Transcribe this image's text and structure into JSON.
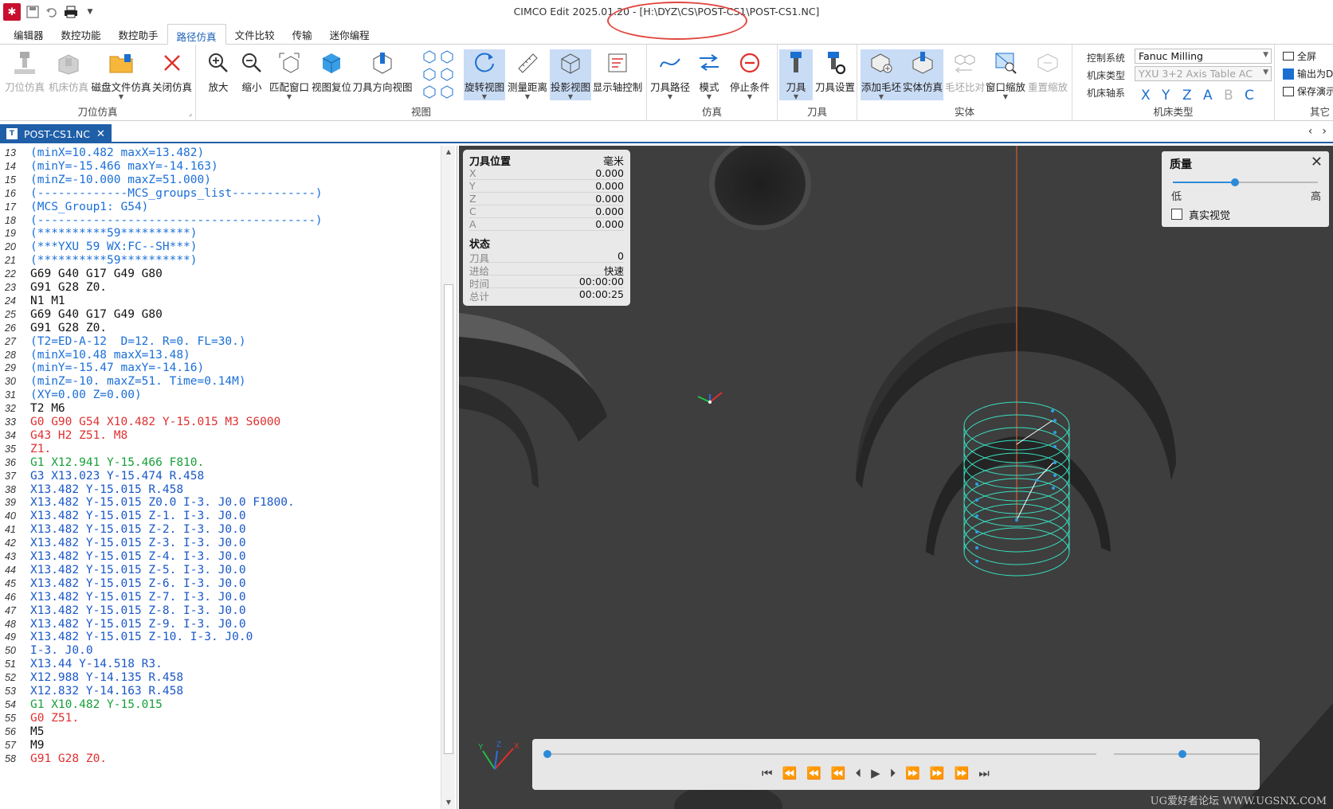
{
  "titlebar": {
    "title": "CIMCO Edit 2025.01.20 - [H:\\DYZ\\CS\\POST-CS1\\POST-CS1.NC]",
    "qat_icons": [
      "app-logo-icon",
      "save-icon",
      "undo-icon",
      "print-icon",
      "customize-qat-icon"
    ]
  },
  "tabs": [
    "编辑器",
    "数控功能",
    "数控助手",
    "路径仿真",
    "文件比较",
    "传输",
    "迷你编程"
  ],
  "active_tab": "路径仿真",
  "ribbon": {
    "groups": {
      "toolpos": "刀位仿真",
      "view": "视图",
      "sim": "仿真",
      "tool": "刀具",
      "solid": "实体",
      "machine": "机床类型",
      "other": "其它"
    },
    "buttons": {
      "tool_sim": "刀位仿真",
      "machine_sim": "机床仿真",
      "disk_sim": "磁盘文件仿真",
      "close_sim": "关闭仿真",
      "zoom_in": "放大",
      "zoom_out": "缩小",
      "fit_window": "匹配窗口",
      "view_reset": "视图复位",
      "tool_dir_view": "刀具方向视图",
      "rotate_view": "旋转视图",
      "measure": "测量距离",
      "projection": "投影视图",
      "show_axis": "显示轴控制",
      "toolpath": "刀具路径",
      "mode": "模式",
      "stop_cond": "停止条件",
      "tool": "刀具",
      "tool_settings": "刀具设置",
      "add_stock": "添加毛坯",
      "solid_sim": "实体仿真",
      "stock_compare": "毛坯比对",
      "window_zoom": "窗口缩放",
      "rezoom": "重置缩放"
    },
    "machine": {
      "control_label": "控制系统",
      "control_value": "Fanuc Milling",
      "type_label": "机床类型",
      "type_value": "YXU 3+2 Axis  Table AC",
      "axes_label": "机床轴系",
      "axes": [
        "X",
        "Y",
        "Z",
        "A",
        "B",
        "C"
      ]
    },
    "other": {
      "fullscreen": "全屏",
      "export": "输出为D",
      "save_demo": "保存演示"
    }
  },
  "doc_tab": {
    "name": "POST-CS1.NC"
  },
  "editor": {
    "lines": [
      {
        "n": "13",
        "t": "(minX=10.482 maxX=13.482)",
        "c": "comment"
      },
      {
        "n": "14",
        "t": "(minY=-15.466 maxY=-14.163)",
        "c": "comment"
      },
      {
        "n": "15",
        "t": "(minZ=-10.000 maxZ=51.000)",
        "c": "comment"
      },
      {
        "n": "16",
        "t": "(-------------MCS_groups_list------------)",
        "c": "comment"
      },
      {
        "n": "17",
        "t": "(MCS_Group1: G54)",
        "c": "comment"
      },
      {
        "n": "18",
        "t": "(----------------------------------------)",
        "c": "comment"
      },
      {
        "n": "19",
        "t": "(**********59**********)",
        "c": "comment"
      },
      {
        "n": "20",
        "t": "(***YXU 59 WX:FC--SH***)",
        "c": "comment"
      },
      {
        "n": "21",
        "t": "(**********59**********)",
        "c": "comment"
      },
      {
        "n": "22",
        "t": "G69 G40 G17 G49 G80",
        "c": "black"
      },
      {
        "n": "23",
        "t": "G91 G28 Z0.",
        "c": "black"
      },
      {
        "n": "24",
        "t": "N1 M1",
        "c": "black"
      },
      {
        "n": "25",
        "t": "G69 G40 G17 G49 G80",
        "c": "black"
      },
      {
        "n": "26",
        "t": "G91 G28 Z0.",
        "c": "black"
      },
      {
        "n": "27",
        "t": "(T2=ED-A-12  D=12. R=0. FL=30.)",
        "c": "comment"
      },
      {
        "n": "28",
        "t": "(minX=10.48 maxX=13.48)",
        "c": "comment"
      },
      {
        "n": "29",
        "t": "(minY=-15.47 maxY=-14.16)",
        "c": "comment"
      },
      {
        "n": "30",
        "t": "(minZ=-10. maxZ=51. Time=0.14M)",
        "c": "comment"
      },
      {
        "n": "31",
        "t": "(XY=0.00 Z=0.00)",
        "c": "comment"
      },
      {
        "n": "32",
        "t": "T2 M6",
        "c": "black"
      },
      {
        "n": "33",
        "t": "G0 G90 G54 X10.482 Y-15.015 M3 S6000",
        "c": "red"
      },
      {
        "n": "34",
        "t": "G43 H2 Z51. M8",
        "c": "red"
      },
      {
        "n": "35",
        "t": "Z1.",
        "c": "red"
      },
      {
        "n": "36",
        "t": "G1 X12.941 Y-15.466 F810.",
        "c": "green"
      },
      {
        "n": "37",
        "t": "G3 X13.023 Y-15.474 R.458",
        "c": "blue"
      },
      {
        "n": "38",
        "t": "X13.482 Y-15.015 R.458",
        "c": "blue"
      },
      {
        "n": "39",
        "t": "X13.482 Y-15.015 Z0.0 I-3. J0.0 F1800.",
        "c": "blue"
      },
      {
        "n": "40",
        "t": "X13.482 Y-15.015 Z-1. I-3. J0.0",
        "c": "blue"
      },
      {
        "n": "41",
        "t": "X13.482 Y-15.015 Z-2. I-3. J0.0",
        "c": "blue"
      },
      {
        "n": "42",
        "t": "X13.482 Y-15.015 Z-3. I-3. J0.0",
        "c": "blue"
      },
      {
        "n": "43",
        "t": "X13.482 Y-15.015 Z-4. I-3. J0.0",
        "c": "blue"
      },
      {
        "n": "44",
        "t": "X13.482 Y-15.015 Z-5. I-3. J0.0",
        "c": "blue"
      },
      {
        "n": "45",
        "t": "X13.482 Y-15.015 Z-6. I-3. J0.0",
        "c": "blue"
      },
      {
        "n": "46",
        "t": "X13.482 Y-15.015 Z-7. I-3. J0.0",
        "c": "blue"
      },
      {
        "n": "47",
        "t": "X13.482 Y-15.015 Z-8. I-3. J0.0",
        "c": "blue"
      },
      {
        "n": "48",
        "t": "X13.482 Y-15.015 Z-9. I-3. J0.0",
        "c": "blue"
      },
      {
        "n": "49",
        "t": "X13.482 Y-15.015 Z-10. I-3. J0.0",
        "c": "blue"
      },
      {
        "n": "50",
        "t": "I-3. J0.0",
        "c": "blue"
      },
      {
        "n": "51",
        "t": "X13.44 Y-14.518 R3.",
        "c": "blue"
      },
      {
        "n": "52",
        "t": "X12.988 Y-14.135 R.458",
        "c": "blue"
      },
      {
        "n": "53",
        "t": "X12.832 Y-14.163 R.458",
        "c": "blue"
      },
      {
        "n": "54",
        "t": "G1 X10.482 Y-15.015",
        "c": "green"
      },
      {
        "n": "55",
        "t": "G0 Z51.",
        "c": "red"
      },
      {
        "n": "56",
        "t": "M5",
        "c": "black"
      },
      {
        "n": "57",
        "t": "M9",
        "c": "black"
      },
      {
        "n": "58",
        "t": "G91 G28 Z0.",
        "c": "red"
      }
    ]
  },
  "toolpos_panel": {
    "title": "刀具位置",
    "unit": "毫米",
    "coords": [
      {
        "k": "X",
        "v": "0.000"
      },
      {
        "k": "Y",
        "v": "0.000"
      },
      {
        "k": "Z",
        "v": "0.000"
      },
      {
        "k": "C",
        "v": "0.000"
      },
      {
        "k": "A",
        "v": "0.000"
      }
    ],
    "status_title": "状态",
    "status": [
      {
        "k": "刀具",
        "v": "0"
      },
      {
        "k": "进给",
        "v": "快速"
      },
      {
        "k": "时间",
        "v": "00:00:00"
      },
      {
        "k": "总计",
        "v": "00:00:25"
      }
    ]
  },
  "quality_panel": {
    "title": "质量",
    "low": "低",
    "high": "高",
    "level": 0.43,
    "realistic_label": "真实视觉",
    "realistic_checked": false
  },
  "playback": {
    "progress": 0.0,
    "speed": 0.47,
    "buttons": [
      "skip-start-icon",
      "step-back-z-icon",
      "step-back-icon",
      "back-z-icon",
      "back-icon",
      "play-icon",
      "forward-icon",
      "forward-z-icon",
      "step-forward-icon",
      "step-forward-z-icon",
      "skip-end-icon"
    ]
  },
  "watermark": "UG爱好者论坛 WWW.UGSNX.COM",
  "colors": {
    "accent": "#1f5fa8",
    "viewport_bg": "#3e3e3e",
    "toolpath": "#38e0c0",
    "comment": "#1a6fd8",
    "rapid": "#e03030",
    "feed": "#17a03a",
    "arc": "#1a58c8"
  }
}
